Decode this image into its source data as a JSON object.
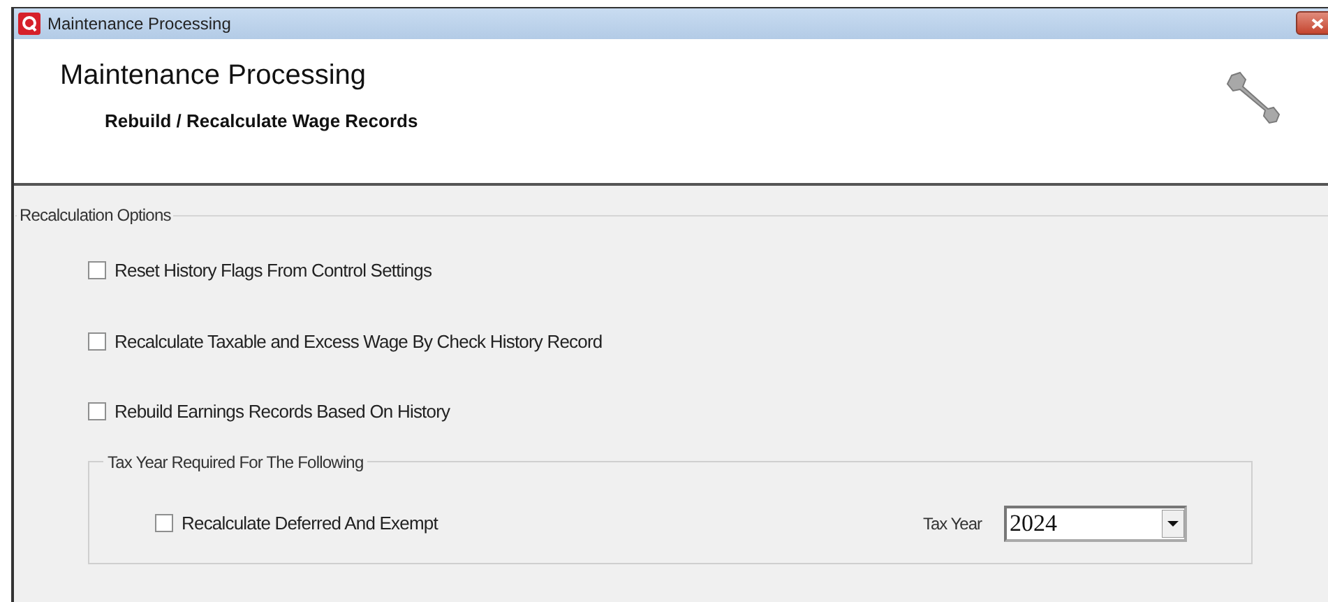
{
  "window": {
    "title": "Maintenance Processing"
  },
  "header": {
    "title": "Maintenance Processing",
    "subtitle": "Rebuild / Recalculate Wage Records"
  },
  "recalculation_options": {
    "legend": "Recalculation Options",
    "options": [
      {
        "label": "Reset History Flags From Control Settings",
        "checked": false
      },
      {
        "label": "Recalculate Taxable and Excess Wage By Check History Record",
        "checked": false
      },
      {
        "label": "Rebuild Earnings Records Based On History",
        "checked": false
      }
    ],
    "tax_year_group": {
      "legend": "Tax Year Required For The Following",
      "options": [
        {
          "label": "Recalculate Deferred And Exempt",
          "checked": false
        }
      ],
      "tax_year_label": "Tax Year",
      "tax_year_value": "2024"
    }
  }
}
